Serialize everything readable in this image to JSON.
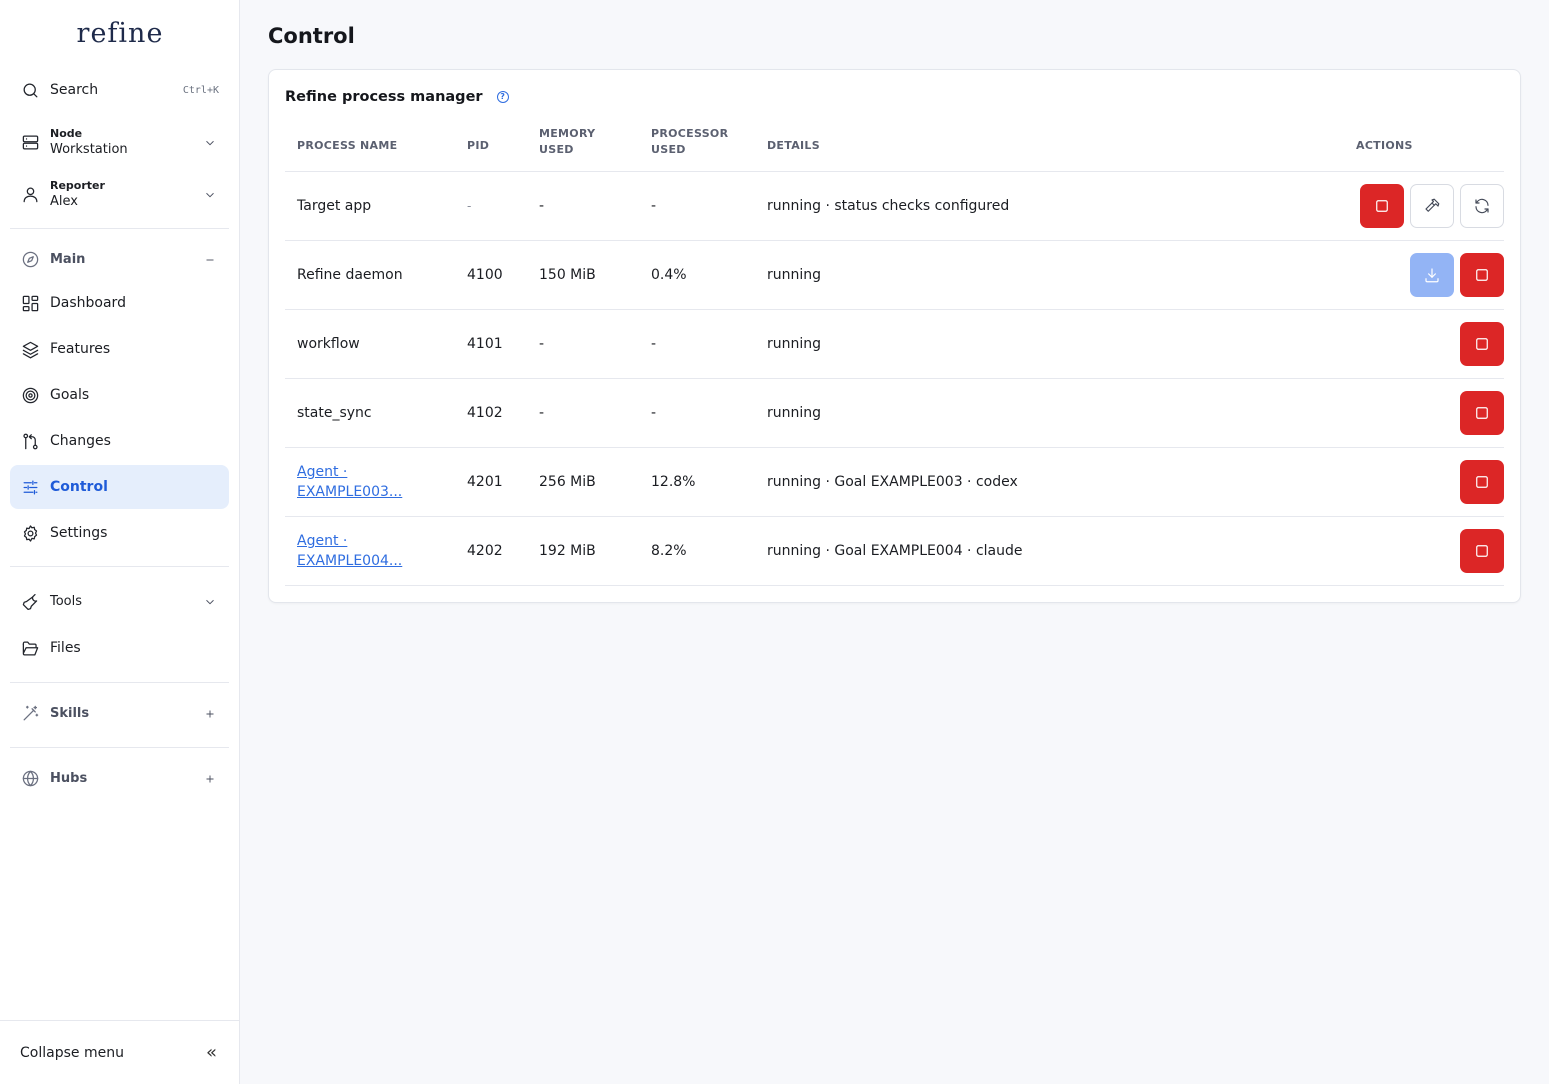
{
  "app": {
    "logo": "refine"
  },
  "sidebar": {
    "search": {
      "label": "Search",
      "shortcut": "Ctrl+K"
    },
    "node": {
      "title": "Node",
      "value": "Workstation"
    },
    "reporter": {
      "title": "Reporter",
      "value": "Alex"
    },
    "main_section": {
      "label": "Main"
    },
    "items": [
      {
        "label": "Dashboard",
        "icon": "dashboard-icon"
      },
      {
        "label": "Features",
        "icon": "layers-icon"
      },
      {
        "label": "Goals",
        "icon": "target-icon"
      },
      {
        "label": "Changes",
        "icon": "git-compare-icon"
      },
      {
        "label": "Control",
        "icon": "sliders-icon",
        "active": true
      },
      {
        "label": "Settings",
        "icon": "gear-icon"
      }
    ],
    "tools": {
      "label": "Tools"
    },
    "files": {
      "label": "Files"
    },
    "skills": {
      "label": "Skills"
    },
    "hubs": {
      "label": "Hubs"
    },
    "collapse": {
      "label": "Collapse menu"
    }
  },
  "page": {
    "title": "Control"
  },
  "card": {
    "title": "Refine process manager",
    "columns": {
      "name": "PROCESS NAME",
      "pid": "PID",
      "memory_1": "MEMORY",
      "memory_2": "USED",
      "processor_1": "PROCESSOR",
      "processor_2": "USED",
      "details": "DETAILS",
      "actions": "ACTIONS"
    },
    "rows": [
      {
        "name": "Target app",
        "pid": "-",
        "memory": "-",
        "cpu": "-",
        "details": "running · status checks configured"
      },
      {
        "name": "Refine daemon",
        "pid": "4100",
        "memory": "150 MiB",
        "cpu": "0.4%",
        "details": "running"
      },
      {
        "name": "workflow",
        "pid": "4101",
        "memory": "-",
        "cpu": "-",
        "details": "running"
      },
      {
        "name": "state_sync",
        "pid": "4102",
        "memory": "-",
        "cpu": "-",
        "details": "running"
      },
      {
        "name_1": "Agent ·",
        "name_2": "EXAMPLE003...",
        "pid": "4201",
        "memory": "256 MiB",
        "cpu": "12.8%",
        "details": "running · Goal EXAMPLE003 · codex"
      },
      {
        "name_1": "Agent ·",
        "name_2": "EXAMPLE004...",
        "pid": "4202",
        "memory": "192 MiB",
        "cpu": "8.2%",
        "details": "running · Goal EXAMPLE004 · claude"
      }
    ]
  },
  "colors": {
    "accent": "#1f5bd8",
    "danger": "#dc2626",
    "active_bg": "#e5eefc",
    "disabled_blue": "#93b4f5"
  }
}
